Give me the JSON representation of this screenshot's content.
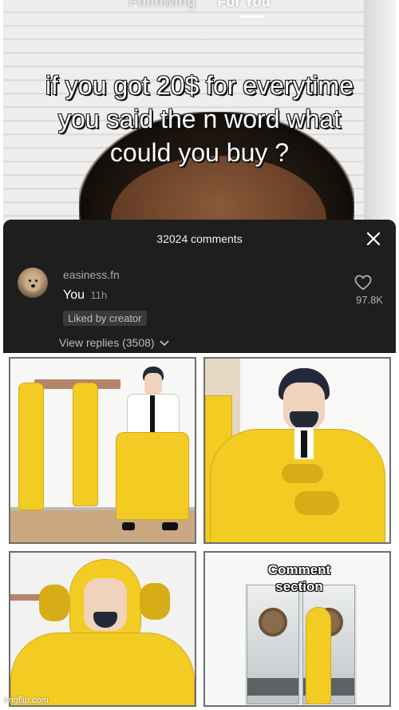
{
  "video": {
    "nav_following": "Following",
    "nav_for_you": "For You",
    "caption_lines": [
      "if you got 20$ for everytime",
      "you said the n word what",
      "could you buy ?"
    ]
  },
  "comments": {
    "header": "32024 comments",
    "close_icon": "close-icon",
    "items": [
      {
        "username": "easiness.fn",
        "text": "You",
        "time": "11h",
        "badge": "Liked by creator",
        "likes": "97.8K",
        "replies": "View replies (3508)"
      }
    ]
  },
  "meme": {
    "label_lines": [
      "Comment",
      "section"
    ]
  },
  "watermark": "imgflip.com",
  "colors": {
    "suit_yellow": "#f2cc22",
    "comment_bg": "#1e1e1e"
  }
}
